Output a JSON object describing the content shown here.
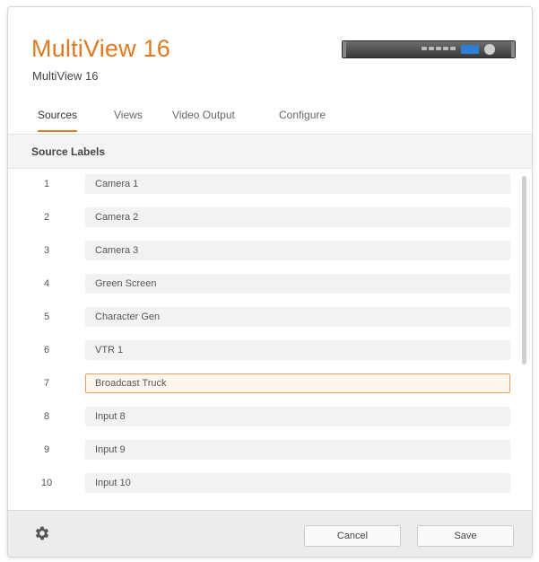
{
  "header": {
    "title": "MultiView 16",
    "subtitle": "MultiView 16"
  },
  "tabs": [
    {
      "label": "Sources",
      "active": true
    },
    {
      "label": "Views",
      "active": false
    },
    {
      "label": "Video Output",
      "active": false
    },
    {
      "label": "Configure",
      "active": false
    }
  ],
  "section": {
    "title": "Source Labels"
  },
  "sources": [
    {
      "number": "1",
      "label": "Camera 1"
    },
    {
      "number": "2",
      "label": "Camera 2"
    },
    {
      "number": "3",
      "label": "Camera 3"
    },
    {
      "number": "4",
      "label": "Green Screen"
    },
    {
      "number": "5",
      "label": "Character Gen"
    },
    {
      "number": "6",
      "label": "VTR 1"
    },
    {
      "number": "7",
      "label": "Broadcast Truck",
      "focused": true
    },
    {
      "number": "8",
      "label": "Input 8"
    },
    {
      "number": "9",
      "label": "Input 9"
    },
    {
      "number": "10",
      "label": "Input 10"
    }
  ],
  "footer": {
    "settings_icon": "gear-icon",
    "cancel_label": "Cancel",
    "save_label": "Save"
  },
  "colors": {
    "accent": "#e07a22",
    "focus_border": "#e8a25b"
  }
}
